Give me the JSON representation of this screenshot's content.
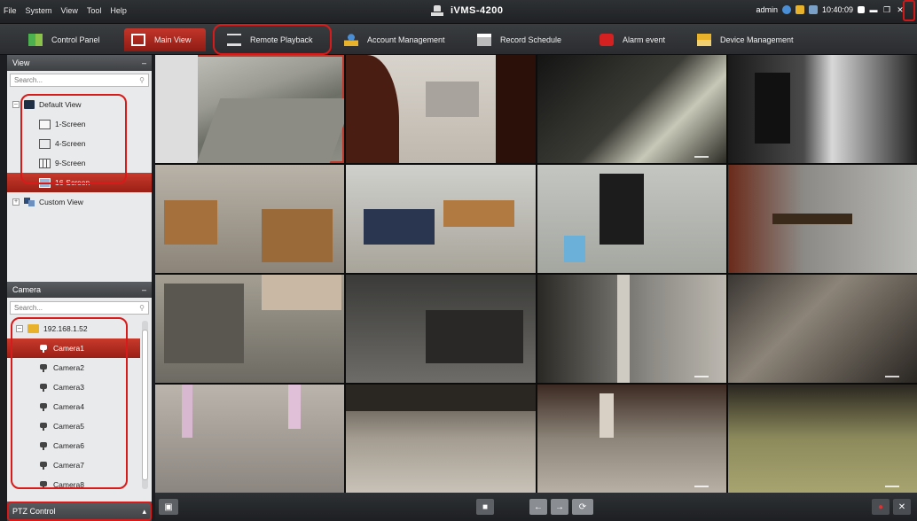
{
  "menubar": {
    "items": [
      "File",
      "System",
      "View",
      "Tool",
      "Help"
    ],
    "app_title": "iVMS-4200",
    "user": "admin",
    "time": "10:40:09"
  },
  "tabs": [
    {
      "label": "Control Panel",
      "icon": "control-panel-icon"
    },
    {
      "label": "Main View",
      "icon": "main-view-icon",
      "active": true
    },
    {
      "label": "Remote Playback",
      "icon": "remote-playback-icon"
    },
    {
      "label": "Account Management",
      "icon": "account-management-icon"
    },
    {
      "label": "Record Schedule",
      "icon": "record-schedule-icon"
    },
    {
      "label": "Alarm event",
      "icon": "alarm-event-icon"
    },
    {
      "label": "Device Management",
      "icon": "device-management-icon"
    }
  ],
  "view_panel": {
    "title": "View",
    "search_placeholder": "Search...",
    "default_view": "Default View",
    "items": [
      "1-Screen",
      "4-Screen",
      "9-Screen",
      "16-Screen"
    ],
    "custom_view": "Custom View"
  },
  "camera_panel": {
    "title": "Camera",
    "search_placeholder": "Search...",
    "device": "192.168.1.52",
    "cameras": [
      "Camera1",
      "Camera2",
      "Camera3",
      "Camera4",
      "Camera5",
      "Camera6",
      "Camera7",
      "Camera8"
    ]
  },
  "ptz": {
    "label": "PTZ Control"
  },
  "colors": {
    "accent": "#b32a20",
    "highlight": "#d91a1a",
    "panel": "#e9eaec"
  }
}
